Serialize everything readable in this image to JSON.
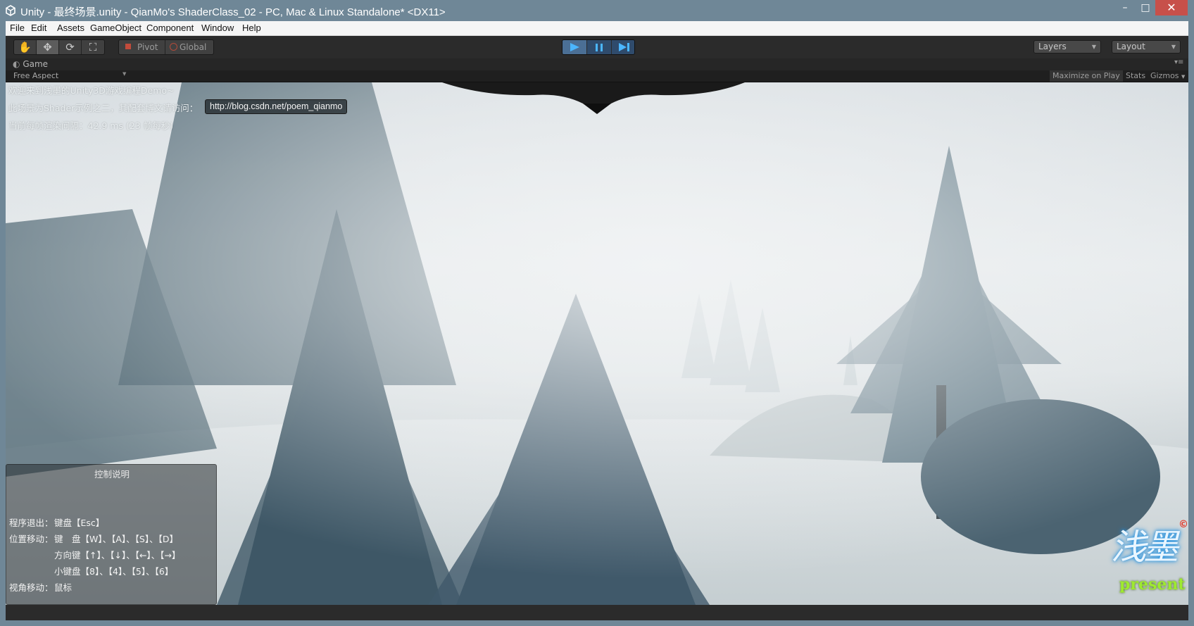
{
  "window": {
    "title": "Unity - 最终场景.unity - QianMo's ShaderClass_02 - PC, Mac & Linux Standalone* <DX11>",
    "minimize_glyph": "–",
    "maximize_glyph": "□",
    "close_glyph": "✕"
  },
  "menu": [
    "File",
    "Edit",
    "Assets",
    "GameObject",
    "Component",
    "Window",
    "Help"
  ],
  "toolbar": {
    "tools": [
      {
        "name": "hand-tool",
        "glyph": "✋"
      },
      {
        "name": "move-tool",
        "glyph": "✥"
      },
      {
        "name": "rotate-tool",
        "glyph": "⟳"
      },
      {
        "name": "scale-tool",
        "glyph": "⛶"
      }
    ],
    "pivot_label": "Pivot",
    "global_label": "Global",
    "layers_label": "Layers",
    "layout_label": "Layout"
  },
  "game_panel": {
    "tab_label": "Game",
    "aspect_label": "Free Aspect",
    "maximize_label": "Maximize on Play",
    "stats_label": "Stats",
    "gizmos_label": "Gizmos"
  },
  "hud": {
    "welcome": "欢迎来到浅墨的Unity3D游戏编程Demo~",
    "visit": "此场景为Shader示例之二，其配套博文请访问：",
    "link": "http://blog.csdn.net/poem_qianmo",
    "frame": "当前每帧渲染间隔：42.9 ms (23 帧每秒)"
  },
  "controls": {
    "title": "控制说明",
    "exit_label": "程序退出：",
    "exit_value": "键盘【Esc】",
    "move_label": "位置移动：",
    "move_keys": "键　盘【W】、【A】、【S】、【D】",
    "arrow_keys": "方向键【↑】、【↓】、【←】、【→】",
    "numpad_keys": "小键盘【8】、【4】、【5】、【6】",
    "view_label": "视角移动：",
    "view_value": "鼠标"
  },
  "logo": {
    "main": "浅墨",
    "sub": "present",
    "copyright": "©"
  },
  "colors": {
    "window_frame": "#6f8797",
    "editor_dark": "#2b2b2b",
    "play_blue": "#4b6f95",
    "close_red": "#c7504a"
  }
}
